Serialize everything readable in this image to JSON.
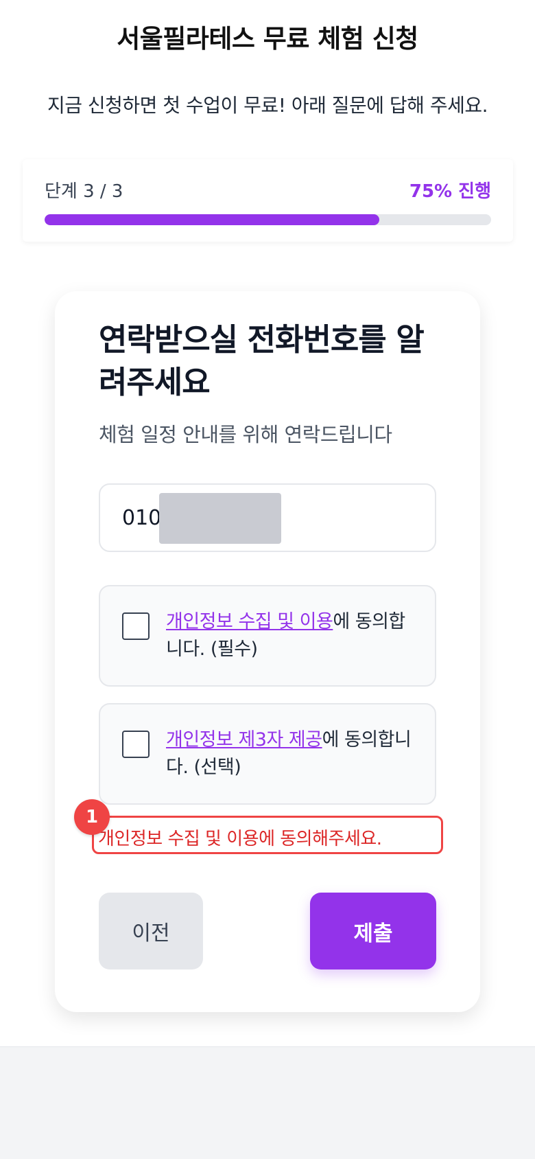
{
  "header": {
    "title": "서울필라테스 무료 체험 신청",
    "subtitle": "지금 신청하면 첫 수업이 무료! 아래 질문에 답해 주세요."
  },
  "progress": {
    "step_label": "단계 3 / 3",
    "percent_label": "75% 진행",
    "value": 0.75
  },
  "question": {
    "title": "연락받으실 전화번호를 알려주세요",
    "description": "체험 일정 안내를 위해 연락드립니다",
    "phone_value": "010"
  },
  "agreements": [
    {
      "link": "개인정보 수집 및 이용",
      "text": "에 동의합니다. (필수)",
      "checked": false
    },
    {
      "link": "개인정보 제3자 제공",
      "text": "에 동의합니다. (선택)",
      "checked": false
    }
  ],
  "error": {
    "badge": "1",
    "message": "개인정보 수집 및 이용에 동의해주세요."
  },
  "buttons": {
    "prev": "이전",
    "submit": "제출"
  },
  "colors": {
    "accent": "#9333ea",
    "error": "#ef4444",
    "track": "#e5e7eb"
  }
}
